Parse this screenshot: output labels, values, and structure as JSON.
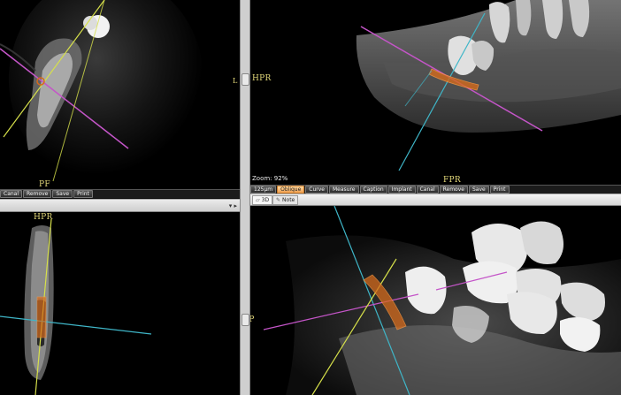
{
  "views": {
    "top_left": {
      "label": "PF"
    },
    "top_right": {
      "label": "FPR",
      "side_label": "HPR",
      "zoom": "Zoom: 92%"
    },
    "bottom_left": {
      "label": "HPR"
    },
    "bottom_right": {
      "side_label": "LP"
    },
    "left_marker": "L"
  },
  "toolbar_left": {
    "buttons": [
      "Canal",
      "Remove",
      "Save",
      "Print"
    ]
  },
  "toolbar_right": {
    "buttons": [
      "125µm",
      "Oblique",
      "Curve",
      "Measure",
      "Caption",
      "Implant",
      "Canal",
      "Remove",
      "Save",
      "Print"
    ],
    "active": "Oblique"
  },
  "tabs": {
    "tab_3d": "3D",
    "tab_note": "Note"
  },
  "panel_controls": "▾ ▸",
  "colors": {
    "magenta_line": "#c455c8",
    "cyan_line": "#3fb6c8",
    "yellow_line": "#d6e04a",
    "orange_canal": "#d46a1c",
    "view_label": "#e4d97a"
  }
}
